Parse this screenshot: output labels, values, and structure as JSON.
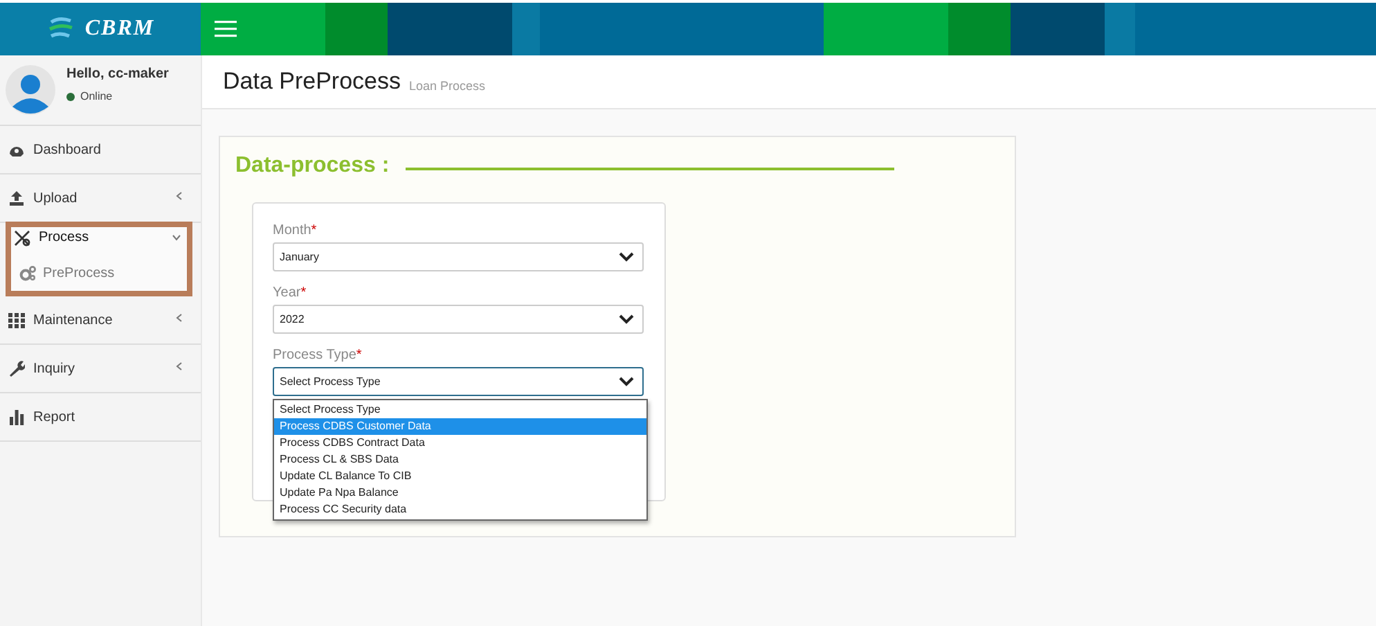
{
  "brand": {
    "name": "CBRM"
  },
  "user": {
    "greeting": "Hello, cc-maker",
    "status": "Online"
  },
  "sidebar": {
    "items": [
      {
        "label": "Dashboard",
        "kind": "link"
      },
      {
        "label": "Upload",
        "kind": "group",
        "expanded": false
      },
      {
        "label": "Process",
        "kind": "group",
        "expanded": true,
        "highlighted": true,
        "children": [
          {
            "label": "PreProcess"
          }
        ]
      },
      {
        "label": "Maintenance",
        "kind": "group",
        "expanded": false
      },
      {
        "label": "Inquiry",
        "kind": "group",
        "expanded": false
      },
      {
        "label": "Report",
        "kind": "link"
      }
    ]
  },
  "page": {
    "title": "Data PreProcess",
    "subtitle": "Loan Process"
  },
  "card": {
    "title": "Data-process :"
  },
  "form": {
    "fields": [
      {
        "label": "Month",
        "required_mark": "*",
        "value": "January",
        "open": false
      },
      {
        "label": "Year",
        "required_mark": "*",
        "value": "2022",
        "open": false
      },
      {
        "label": "Process Type",
        "required_mark": "*",
        "value": "Select Process Type",
        "open": true,
        "options": [
          {
            "label": "Select Process Type",
            "highlighted": false
          },
          {
            "label": "Process CDBS Customer Data",
            "highlighted": true
          },
          {
            "label": "Process CDBS Contract Data",
            "highlighted": false
          },
          {
            "label": "Process CL & SBS Data",
            "highlighted": false
          },
          {
            "label": "Update CL Balance To CIB",
            "highlighted": false
          },
          {
            "label": "Update Pa Npa Balance",
            "highlighted": false
          },
          {
            "label": "Process CC Security data",
            "highlighted": false
          }
        ]
      }
    ]
  }
}
